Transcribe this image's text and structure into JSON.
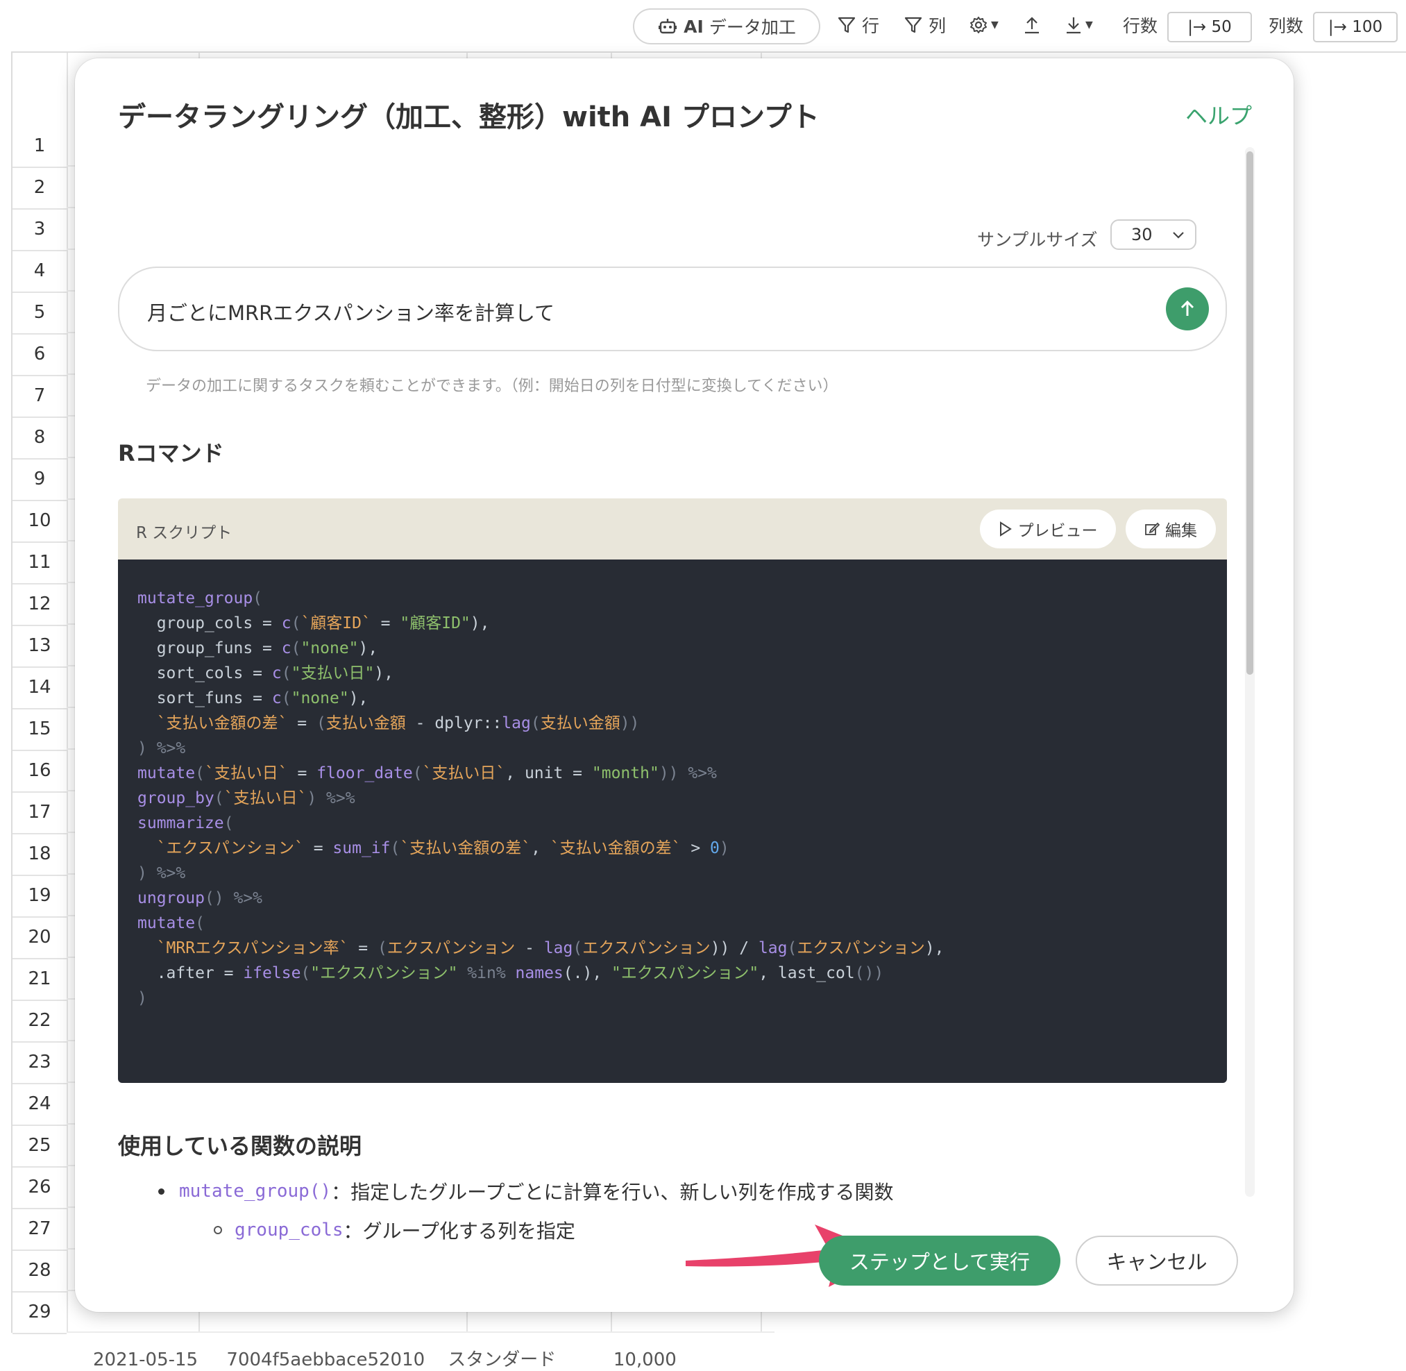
{
  "toolbar": {
    "ai_button": {
      "bold": "AI",
      "label": "データ加工"
    },
    "filter_rows": "行",
    "filter_cols": "列",
    "row_count_label": "行数",
    "row_count_value": "|→ 50",
    "col_count_label": "列数",
    "col_count_value": "|→ 100"
  },
  "grid": {
    "rows": [
      "1",
      "2",
      "3",
      "4",
      "5",
      "6",
      "7",
      "8",
      "9",
      "10",
      "11",
      "12",
      "13",
      "14",
      "15",
      "16",
      "17",
      "18",
      "19",
      "20",
      "21",
      "22",
      "23",
      "24",
      "25",
      "26",
      "27",
      "28",
      "29"
    ],
    "last_row_text": "2021-05-15     7004f5aebbace52010    スタンダード          10,000"
  },
  "modal": {
    "title": "データラングリング（加工、整形）with AI プロンプト",
    "help": "ヘルプ",
    "sample_size_label": "サンプルサイズ",
    "sample_size_value": "30",
    "prompt_text": "月ごとにMRRエクスパンション率を計算して",
    "hint": "データの加工に関するタスクを頼むことができます。（例：開始日の列を日付型に変換してください）",
    "r_command_title": "Rコマンド",
    "script_label": "R スクリプト",
    "preview_button": "プレビュー",
    "edit_button": "編集",
    "code_lines": [
      [
        {
          "t": "mutate_group",
          "c": "fn"
        },
        {
          "t": "(",
          "c": "op"
        }
      ],
      [
        {
          "t": "  group_cols = ",
          "c": "plain"
        },
        {
          "t": "c",
          "c": "fn"
        },
        {
          "t": "(",
          "c": "op"
        },
        {
          "t": "`顧客ID`",
          "c": "bt"
        },
        {
          "t": " = ",
          "c": "plain"
        },
        {
          "t": "\"顧客ID\"",
          "c": "str"
        },
        {
          "t": "),",
          "c": "plain"
        }
      ],
      [
        {
          "t": "  group_funs = ",
          "c": "plain"
        },
        {
          "t": "c",
          "c": "fn"
        },
        {
          "t": "(",
          "c": "op"
        },
        {
          "t": "\"none\"",
          "c": "str"
        },
        {
          "t": "),",
          "c": "plain"
        }
      ],
      [
        {
          "t": "  sort_cols = ",
          "c": "plain"
        },
        {
          "t": "c",
          "c": "fn"
        },
        {
          "t": "(",
          "c": "op"
        },
        {
          "t": "\"支払い日\"",
          "c": "str"
        },
        {
          "t": "),",
          "c": "plain"
        }
      ],
      [
        {
          "t": "  sort_funs = ",
          "c": "plain"
        },
        {
          "t": "c",
          "c": "fn"
        },
        {
          "t": "(",
          "c": "op"
        },
        {
          "t": "\"none\"",
          "c": "str"
        },
        {
          "t": "),",
          "c": "plain"
        }
      ],
      [
        {
          "t": "  `支払い金額の差`",
          "c": "bt"
        },
        {
          "t": " = ",
          "c": "plain"
        },
        {
          "t": "(",
          "c": "op"
        },
        {
          "t": "支払い金額",
          "c": "bt"
        },
        {
          "t": " - dplyr::",
          "c": "plain"
        },
        {
          "t": "lag",
          "c": "fn"
        },
        {
          "t": "(",
          "c": "op"
        },
        {
          "t": "支払い金額",
          "c": "bt"
        },
        {
          "t": "))",
          "c": "op"
        }
      ],
      [
        {
          "t": ") %>%",
          "c": "op"
        }
      ],
      [
        {
          "t": "mutate",
          "c": "fn"
        },
        {
          "t": "(",
          "c": "op"
        },
        {
          "t": "`支払い日`",
          "c": "bt"
        },
        {
          "t": " = ",
          "c": "plain"
        },
        {
          "t": "floor_date",
          "c": "fn"
        },
        {
          "t": "(",
          "c": "op"
        },
        {
          "t": "`支払い日`",
          "c": "bt"
        },
        {
          "t": ", unit = ",
          "c": "plain"
        },
        {
          "t": "\"month\"",
          "c": "str"
        },
        {
          "t": ")) %>%",
          "c": "op"
        }
      ],
      [
        {
          "t": "group_by",
          "c": "fn"
        },
        {
          "t": "(",
          "c": "op"
        },
        {
          "t": "`支払い日`",
          "c": "bt"
        },
        {
          "t": ") %>%",
          "c": "op"
        }
      ],
      [
        {
          "t": "summarize",
          "c": "fn"
        },
        {
          "t": "(",
          "c": "op"
        }
      ],
      [
        {
          "t": "  `エクスパンション`",
          "c": "bt"
        },
        {
          "t": " = ",
          "c": "plain"
        },
        {
          "t": "sum_if",
          "c": "fn"
        },
        {
          "t": "(",
          "c": "op"
        },
        {
          "t": "`支払い金額の差`",
          "c": "bt"
        },
        {
          "t": ", ",
          "c": "plain"
        },
        {
          "t": "`支払い金額の差`",
          "c": "bt"
        },
        {
          "t": " > ",
          "c": "plain"
        },
        {
          "t": "0",
          "c": "num"
        },
        {
          "t": ")",
          "c": "op"
        }
      ],
      [
        {
          "t": ") %>%",
          "c": "op"
        }
      ],
      [
        {
          "t": "ungroup",
          "c": "fn"
        },
        {
          "t": "() %>%",
          "c": "op"
        }
      ],
      [
        {
          "t": "mutate",
          "c": "fn"
        },
        {
          "t": "(",
          "c": "op"
        }
      ],
      [
        {
          "t": "  `MRRエクスパンション率`",
          "c": "bt"
        },
        {
          "t": " = ",
          "c": "plain"
        },
        {
          "t": "(",
          "c": "op"
        },
        {
          "t": "エクスパンション",
          "c": "bt"
        },
        {
          "t": " - ",
          "c": "plain"
        },
        {
          "t": "lag",
          "c": "fn"
        },
        {
          "t": "(",
          "c": "op"
        },
        {
          "t": "エクスパンション",
          "c": "bt"
        },
        {
          "t": ")) / ",
          "c": "plain"
        },
        {
          "t": "lag",
          "c": "fn"
        },
        {
          "t": "(",
          "c": "op"
        },
        {
          "t": "エクスパンション",
          "c": "bt"
        },
        {
          "t": "),",
          "c": "plain"
        }
      ],
      [
        {
          "t": "  .after = ",
          "c": "plain"
        },
        {
          "t": "ifelse",
          "c": "fn"
        },
        {
          "t": "(",
          "c": "op"
        },
        {
          "t": "\"エクスパンション\"",
          "c": "str"
        },
        {
          "t": " %in% ",
          "c": "op"
        },
        {
          "t": "names",
          "c": "fn"
        },
        {
          "t": "(.), ",
          "c": "plain"
        },
        {
          "t": "\"エクスパンション\"",
          "c": "str"
        },
        {
          "t": ", last_col",
          "c": "plain"
        },
        {
          "t": "())",
          "c": "op"
        }
      ],
      [
        {
          "t": ")",
          "c": "op"
        }
      ]
    ],
    "functions_title": "使用している関数の説明",
    "functions": [
      {
        "name": "mutate_group()",
        "desc": "：指定したグループごとに計算を行い、新しい列を作成する関数",
        "level": 1
      },
      {
        "name": "group_cols",
        "desc": "：グループ化する列を指定",
        "level": 2
      }
    ],
    "run_button": "ステップとして実行",
    "cancel_button": "キャンセル"
  }
}
